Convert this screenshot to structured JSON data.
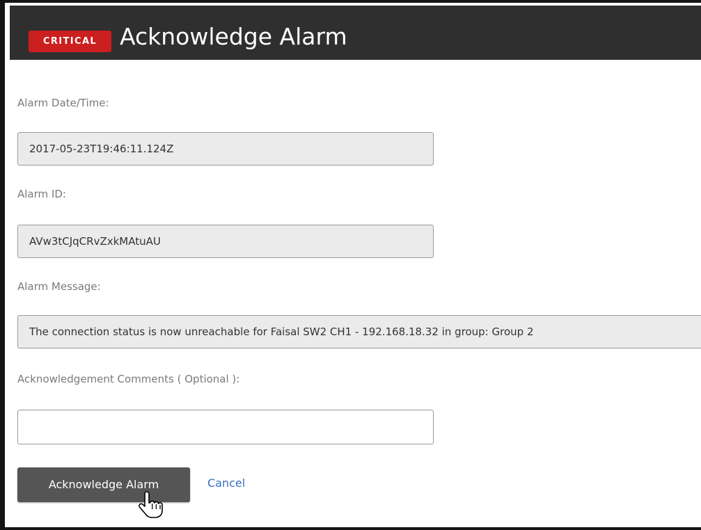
{
  "dialog": {
    "severity_badge": "CRITICAL",
    "title": "Acknowledge Alarm"
  },
  "fields": {
    "alarm_datetime": {
      "label": "Alarm Date/Time:",
      "value": "2017-05-23T19:46:11.124Z"
    },
    "alarm_id": {
      "label": "Alarm ID:",
      "value": "AVw3tCJqCRvZxkMAtuAU"
    },
    "alarm_message": {
      "label": "Alarm Message:",
      "value": "The connection status is now unreachable for Faisal SW2 CH1 - 192.168.18.32 in group: Group 2"
    },
    "comments": {
      "label": "Acknowledgement Comments ( Optional ):",
      "value": ""
    }
  },
  "actions": {
    "acknowledge_label": "Acknowledge Alarm",
    "cancel_label": "Cancel"
  },
  "colors": {
    "titlebar": "#2f2f2f",
    "critical_badge": "#cc1f1f",
    "primary_button": "#555555",
    "link": "#3a6fc4"
  },
  "cursor": {
    "icon": "hand-pointer-icon"
  }
}
